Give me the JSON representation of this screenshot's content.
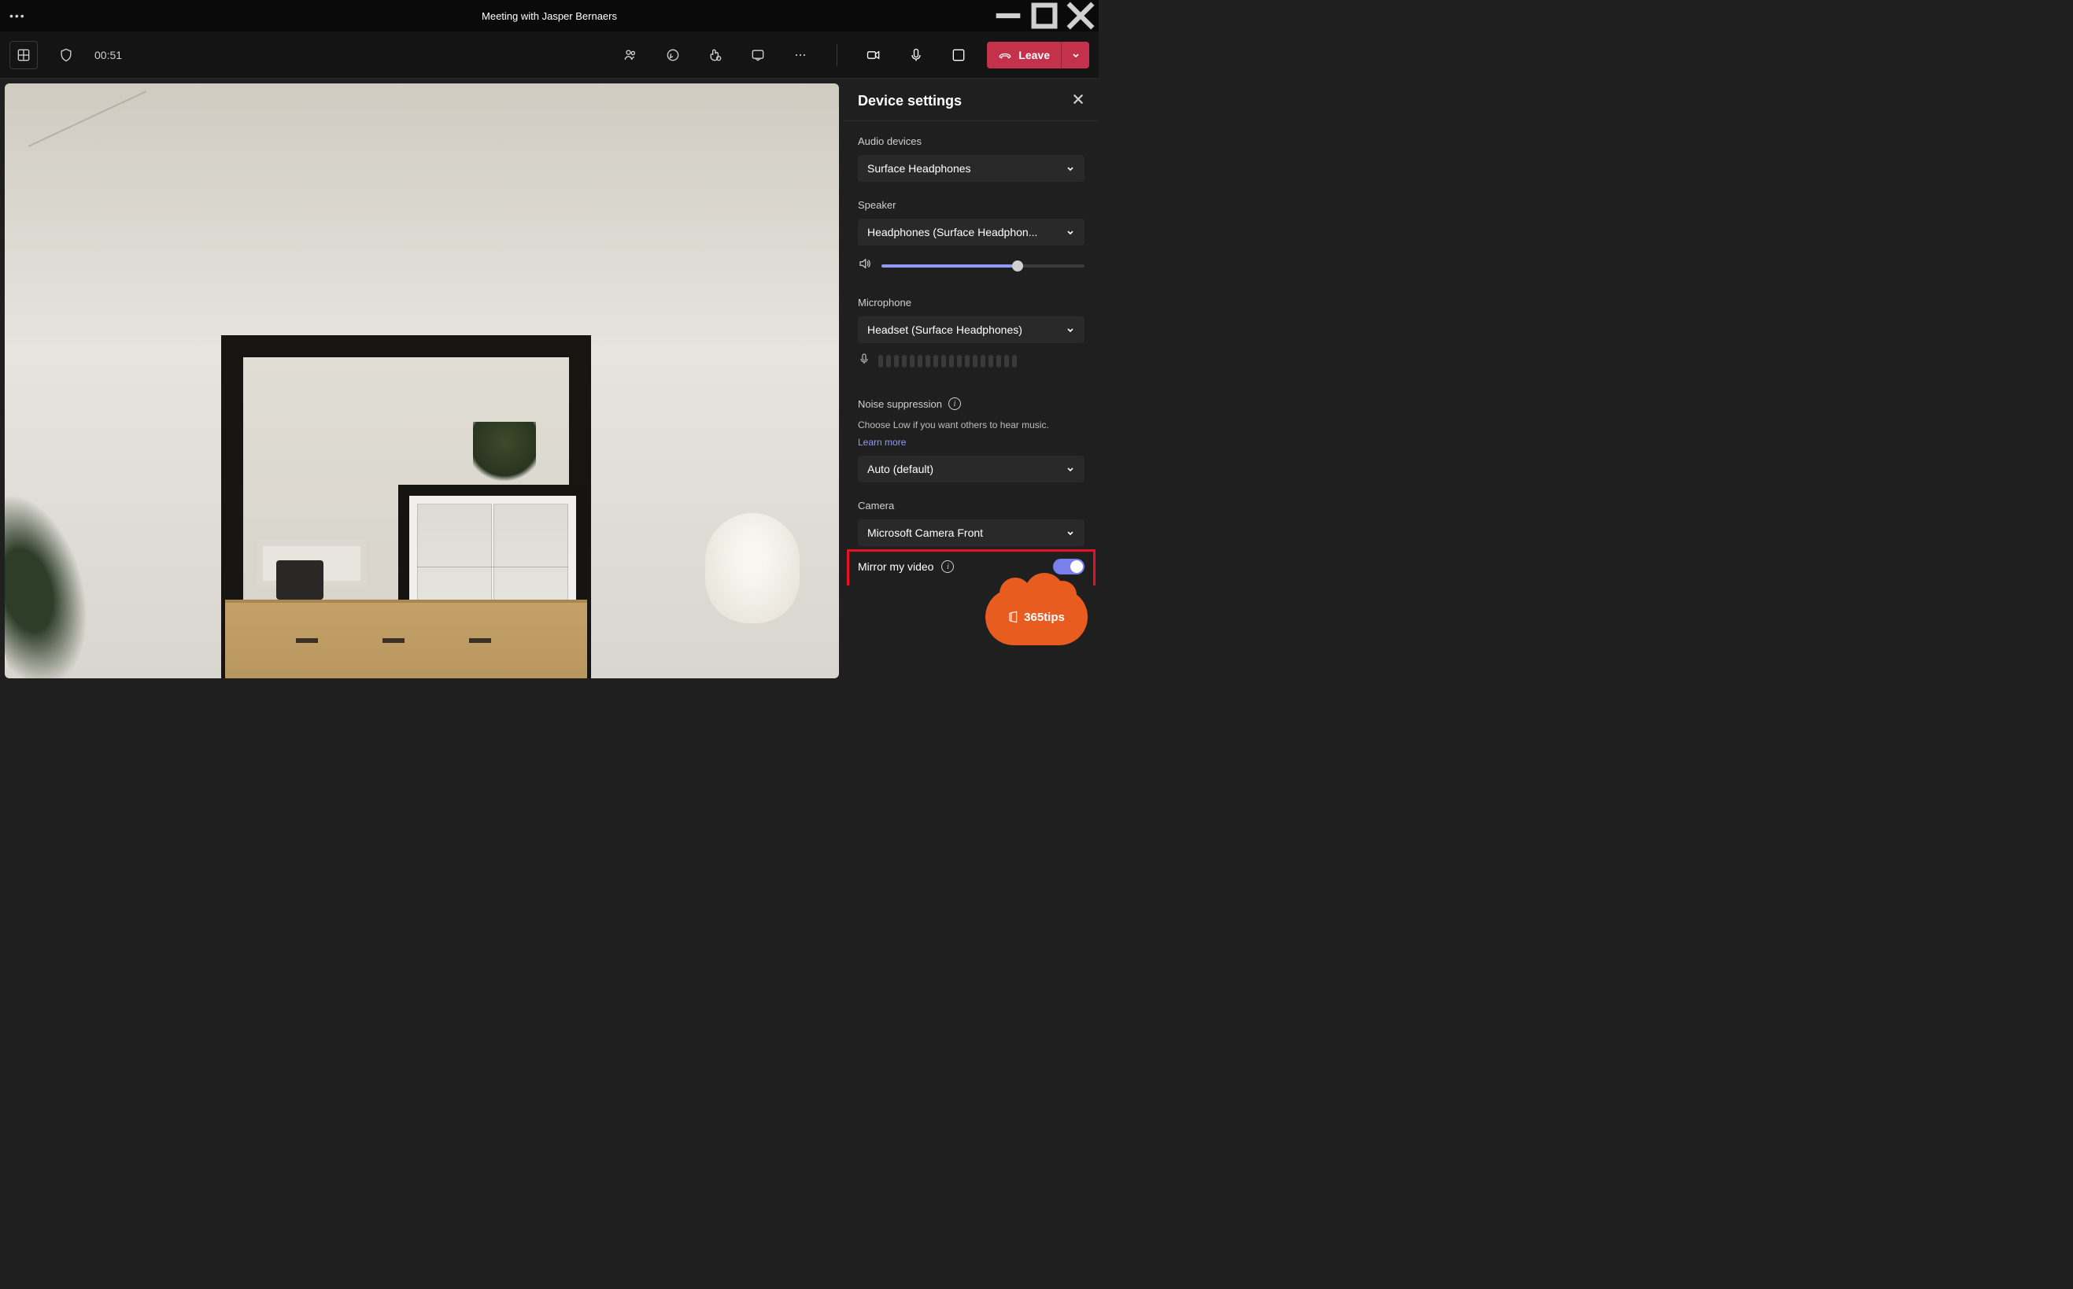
{
  "titlebar": {
    "title": "Meeting with Jasper Bernaers"
  },
  "toolbar": {
    "timer": "00:51",
    "leave_label": "Leave"
  },
  "panel": {
    "title": "Device settings",
    "audio_devices": {
      "label": "Audio devices",
      "value": "Surface Headphones"
    },
    "speaker": {
      "label": "Speaker",
      "value": "Headphones (Surface Headphon...",
      "volume_percent": 67
    },
    "microphone": {
      "label": "Microphone",
      "value": "Headset (Surface Headphones)"
    },
    "noise_suppression": {
      "label": "Noise suppression",
      "description": "Choose Low if you want others to hear music.",
      "learn_more": "Learn more",
      "value": "Auto (default)"
    },
    "camera": {
      "label": "Camera",
      "value": "Microsoft Camera Front"
    },
    "mirror": {
      "label": "Mirror my video",
      "enabled": true
    }
  },
  "badge": {
    "text": "365tips"
  }
}
